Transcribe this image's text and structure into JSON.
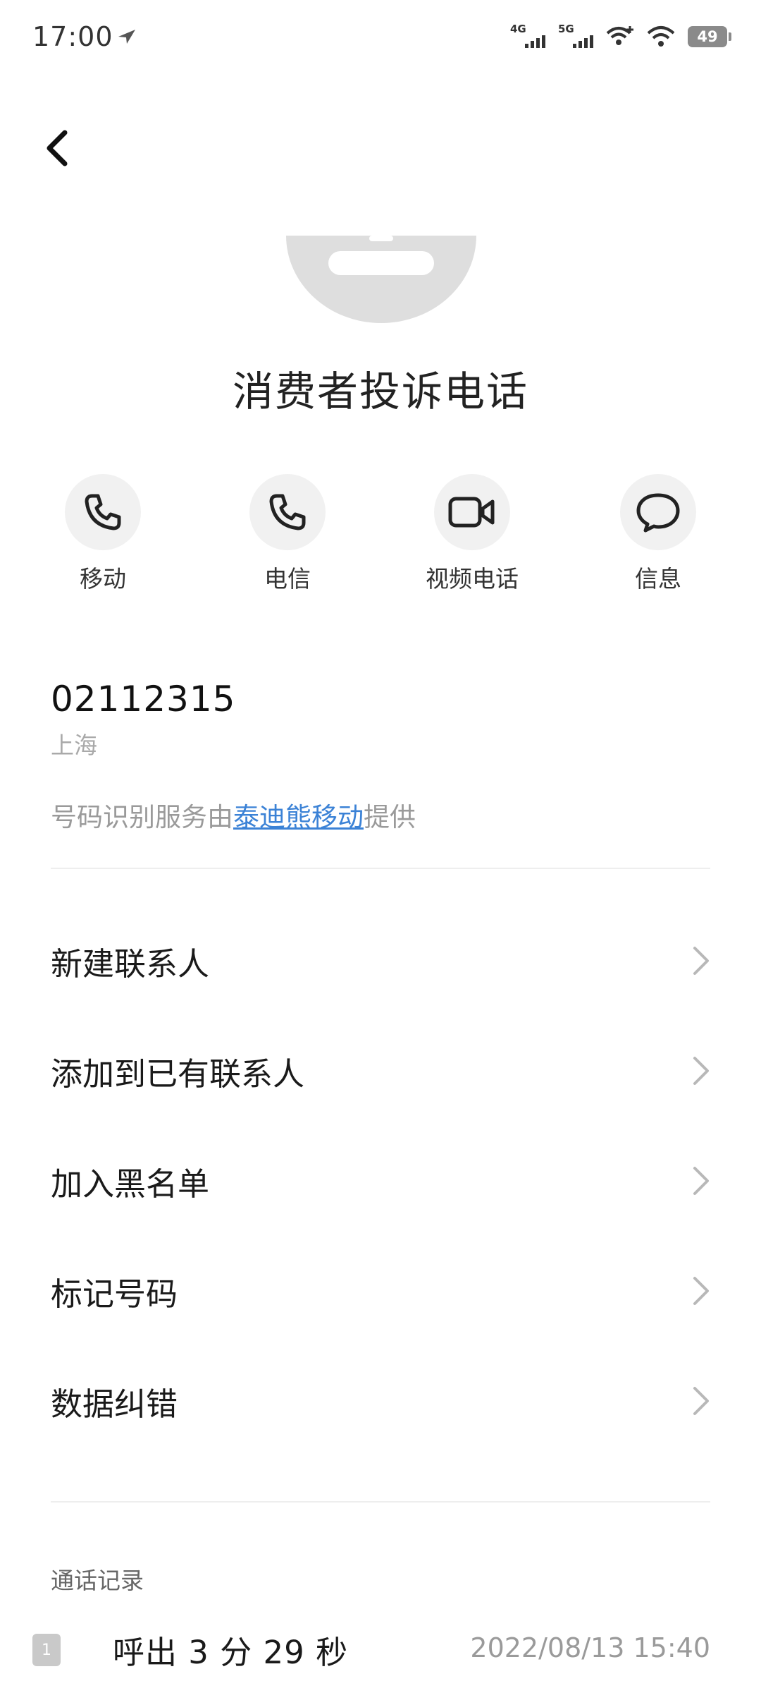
{
  "status_bar": {
    "time": "17:00",
    "signal_1_label": "4G",
    "signal_2_label": "5G",
    "battery": "49"
  },
  "contact": {
    "name": "消费者投诉电话",
    "number": "02112315",
    "location": "上海"
  },
  "actions": [
    {
      "label": "移动",
      "icon": "phone-icon"
    },
    {
      "label": "电信",
      "icon": "phone-icon"
    },
    {
      "label": "视频电话",
      "icon": "video-camera-icon"
    },
    {
      "label": "信息",
      "icon": "message-bubble-icon"
    }
  ],
  "provider_note": {
    "prefix": "号码识别服务由",
    "link": "泰迪熊移动",
    "suffix": "提供"
  },
  "menu": [
    {
      "label": "新建联系人"
    },
    {
      "label": "添加到已有联系人"
    },
    {
      "label": "加入黑名单"
    },
    {
      "label": "标记号码"
    },
    {
      "label": "数据纠错"
    }
  ],
  "call_log": {
    "title": "通话记录",
    "entries": [
      {
        "sim": "1",
        "text": "呼出 3 分 29 秒",
        "datetime": "2022/08/13 15:40"
      }
    ]
  },
  "colors": {
    "accent_link": "#3b82d6",
    "secondary_text": "#9a9a9a",
    "action_circle": "#f1f1f1"
  }
}
